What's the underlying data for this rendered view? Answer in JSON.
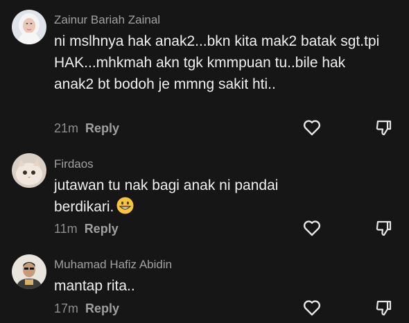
{
  "comments": [
    {
      "author": "Zainur Bariah Zainal",
      "text": "ni mslhnya hak anak2...bkn kita mak2 batak sgt.tpi HAK...mhkmah akn tgk kmmpuan tu..bile hak anak2 bt bodoh je mmng sakit hti..",
      "time": "21m",
      "reply_label": "Reply",
      "avatar_icon": "user-avatar-hijab",
      "like_icon": "heart-outline-icon",
      "dislike_icon": "thumbs-down-icon"
    },
    {
      "author": "Firdaos",
      "text": "jutawan tu nak bagi anak ni pandai berdikari.",
      "emoji": "grinning-face-emoji",
      "time": "11m",
      "reply_label": "Reply",
      "avatar_icon": "cat-avatar",
      "like_icon": "heart-outline-icon",
      "dislike_icon": "thumbs-down-icon"
    },
    {
      "author": "Muhamad Hafiz Abidin",
      "text": "mantap rita..",
      "time": "17m",
      "reply_label": "Reply",
      "avatar_icon": "user-avatar-man",
      "like_icon": "heart-outline-icon",
      "dislike_icon": "thumbs-down-icon"
    }
  ],
  "colors": {
    "background": "#161616",
    "text": "#f0f0f0",
    "author": "#a2a2a2",
    "meta": "#9a9a9a"
  }
}
